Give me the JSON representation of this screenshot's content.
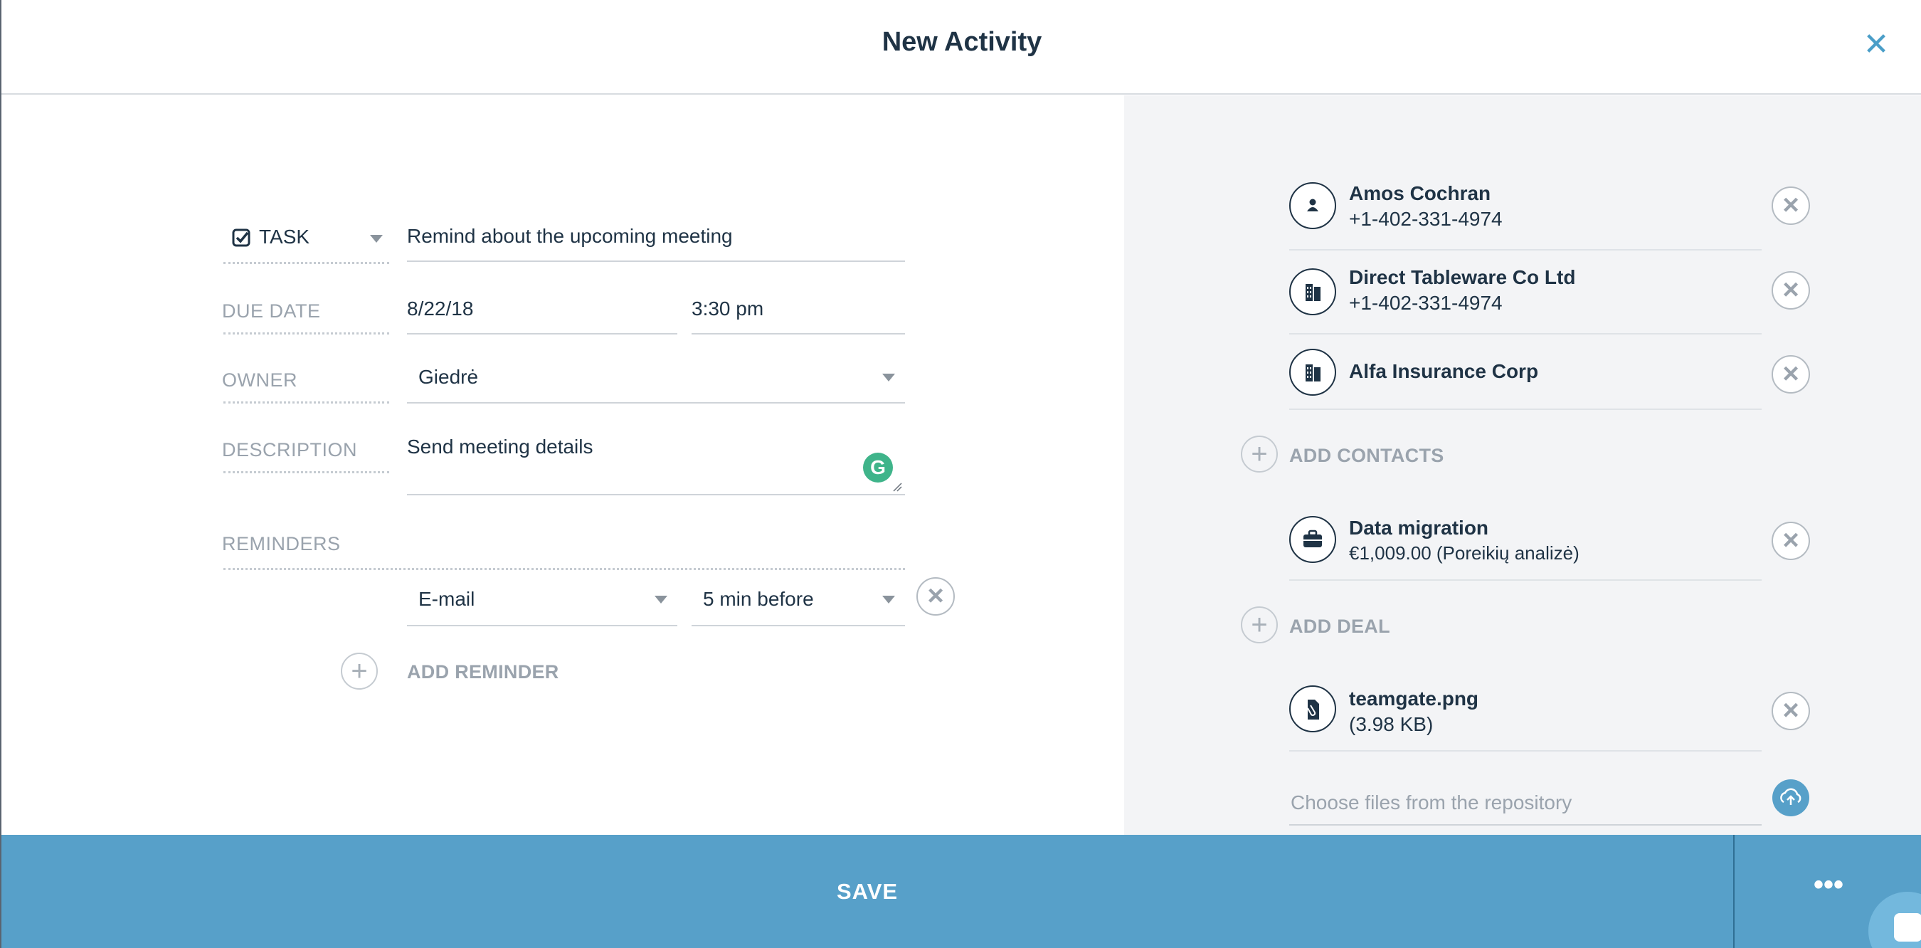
{
  "header": {
    "title": "New Activity",
    "close_icon": "close-icon"
  },
  "form": {
    "type_label": "TASK",
    "subject_value": "Remind about the upcoming meeting",
    "due_date": {
      "label": "DUE DATE",
      "date": "8/22/18",
      "time": "3:30 pm"
    },
    "owner": {
      "label": "OWNER",
      "value": "Giedrė"
    },
    "description": {
      "label": "DESCRIPTION",
      "value": "Send meeting details"
    },
    "reminders": {
      "label": "REMINDERS",
      "items": [
        {
          "method": "E-mail",
          "offset": "5 min before"
        }
      ],
      "add_label": "ADD REMINDER"
    }
  },
  "related": {
    "contacts": [
      {
        "name": "Amos Cochran",
        "sub": "+1-402-331-4974",
        "icon": "person-icon"
      },
      {
        "name": "Direct Tableware Co Ltd",
        "sub": "+1-402-331-4974",
        "icon": "building-icon"
      },
      {
        "name": "Alfa Insurance Corp",
        "sub": "",
        "icon": "building-icon"
      }
    ],
    "add_contacts_label": "ADD CONTACTS",
    "deals": [
      {
        "name": "Data migration",
        "sub": "€1,009.00 (Poreikių analizė)",
        "icon": "briefcase-icon"
      }
    ],
    "add_deal_label": "ADD DEAL",
    "files": [
      {
        "name": "teamgate.png",
        "sub": "(3.98 KB)",
        "icon": "paperclip-icon"
      }
    ],
    "repository_placeholder": "Choose files from the repository"
  },
  "footer": {
    "save_label": "SAVE",
    "more_label": "•••"
  },
  "colors": {
    "accent": "#57a0c9",
    "text": "#1f3345",
    "muted": "#9aa3ad",
    "grammarly": "#3fb48a"
  }
}
